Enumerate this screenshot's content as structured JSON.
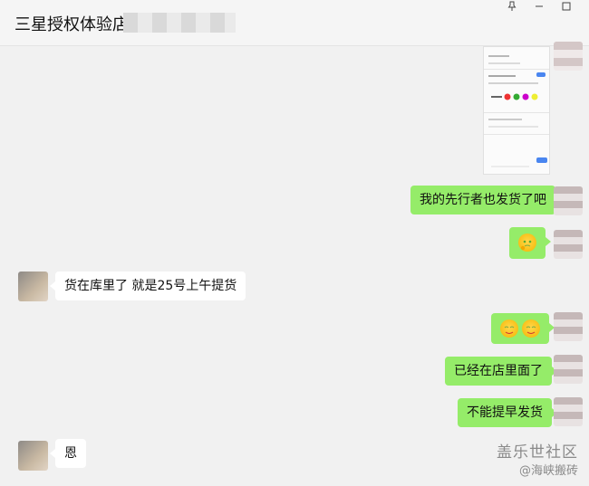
{
  "window": {
    "title": "三星授权体验店",
    "pin_icon": "pin-icon",
    "minimize_icon": "minimize-icon",
    "maximize_icon": "maximize-icon"
  },
  "messages": [
    {
      "side": "right",
      "kind": "image"
    },
    {
      "side": "right",
      "kind": "text",
      "text": "我的先行者也发货了吧"
    },
    {
      "side": "right",
      "kind": "emoji",
      "emoji": "thinking-face"
    },
    {
      "side": "left",
      "kind": "text",
      "text": "货在库里了  就是25号上午提货"
    },
    {
      "side": "right",
      "kind": "emoji",
      "emoji": "smiling-faces"
    },
    {
      "side": "right",
      "kind": "text",
      "text": "已经在店里面了"
    },
    {
      "side": "right",
      "kind": "text",
      "text": "不能提早发货"
    },
    {
      "side": "left",
      "kind": "text",
      "text": "恩"
    }
  ],
  "watermark": {
    "brand": "盖乐世社区",
    "user": "@海峡搬砖"
  }
}
